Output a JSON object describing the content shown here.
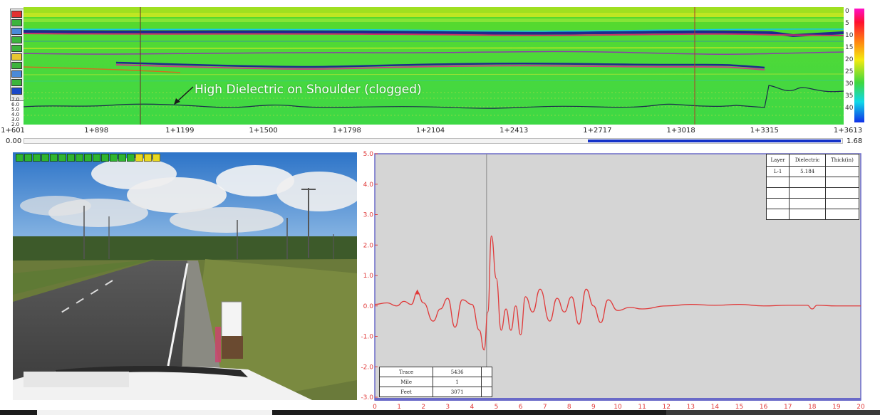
{
  "gpr": {
    "annotation": "High Dielectric on Shoulder (clogged)",
    "chainage_labels": [
      "1+601",
      "1+898",
      "1+1199",
      "1+1500",
      "1+1798",
      "1+2104",
      "1+2413",
      "1+2717",
      "1+3018",
      "1+3315",
      "1+3613"
    ],
    "depth_labels": [
      "0",
      "5",
      "10",
      "15",
      "20",
      "25",
      "30",
      "35",
      "40"
    ],
    "waveform_scale_labels": [
      "7.0",
      "6.0",
      "5.0",
      "4.0",
      "3.0",
      "2.0"
    ],
    "scroll": {
      "start_label": "0.00",
      "end_label": "1.68",
      "position_fraction": 0.69
    },
    "colors": {
      "background": "#48d62e",
      "band": "#1c2a8c",
      "marker": "#6b2a2a"
    }
  },
  "waveform": {
    "chart_data": {
      "type": "line",
      "x_ticks": [
        "0",
        "1",
        "2",
        "3",
        "4",
        "5",
        "6",
        "7",
        "8",
        "9",
        "10",
        "11",
        "12",
        "13",
        "14",
        "15",
        "16",
        "17",
        "18",
        "19",
        "20"
      ],
      "y_ticks": [
        "5.0",
        "4.0",
        "3.0",
        "2.0",
        "1.0",
        "0.0",
        "-1.0",
        "-2.0",
        "-3.0"
      ],
      "xlim": [
        0,
        20
      ],
      "ylim": [
        -3,
        5
      ],
      "cursor_x": 4.6,
      "marker": [
        1.75,
        0.45
      ],
      "series": [
        {
          "x": [
            0,
            0.5,
            0.9,
            1.2,
            1.5,
            1.75,
            2.0,
            2.4,
            2.7,
            3.0,
            3.3,
            3.6,
            4.0,
            4.3,
            4.5,
            4.65,
            4.8,
            5.0,
            5.2,
            5.4,
            5.6,
            5.8,
            6.0,
            6.2,
            6.5,
            6.8,
            7.2,
            7.5,
            7.8,
            8.1,
            8.4,
            8.7,
            9.0,
            9.3,
            9.6,
            10.0,
            10.5,
            11.0,
            12.0,
            13.0,
            14.0,
            15.0,
            16.0,
            17.0,
            17.8,
            18.0,
            18.2,
            19.0,
            20.0
          ],
          "y": [
            0.05,
            0.1,
            0.0,
            0.15,
            0.05,
            0.45,
            0.1,
            -0.5,
            -0.1,
            0.25,
            -0.7,
            0.2,
            0.05,
            -0.8,
            -1.45,
            -0.2,
            2.3,
            0.9,
            -0.8,
            -0.1,
            -0.8,
            0.0,
            -0.95,
            0.3,
            -0.2,
            0.55,
            -0.5,
            0.25,
            -0.2,
            0.3,
            -0.6,
            0.55,
            0.0,
            -0.55,
            0.2,
            -0.15,
            -0.05,
            -0.1,
            0.0,
            0.05,
            0.02,
            0.05,
            0.0,
            0.02,
            0.02,
            -0.1,
            0.02,
            0.0,
            0.0
          ],
          "color": "#e03a3a"
        }
      ]
    },
    "layer_table": {
      "headers": [
        "Layer",
        "Dielectric",
        "Thick(in)"
      ],
      "rows": [
        [
          "L-1",
          "5.184",
          ""
        ],
        [
          "",
          "",
          ""
        ],
        [
          "",
          "",
          ""
        ],
        [
          "",
          "",
          ""
        ],
        [
          "",
          "",
          ""
        ]
      ]
    },
    "trace_table": {
      "rows": [
        {
          "label": "Trace",
          "value": "5436"
        },
        {
          "label": "Mile",
          "value": "1"
        },
        {
          "label": "Feet",
          "value": "3071"
        }
      ]
    },
    "colors": {
      "background": "#d5d5d5",
      "frame": "#6a6ac8",
      "axis_text": "#e03a3a"
    }
  }
}
